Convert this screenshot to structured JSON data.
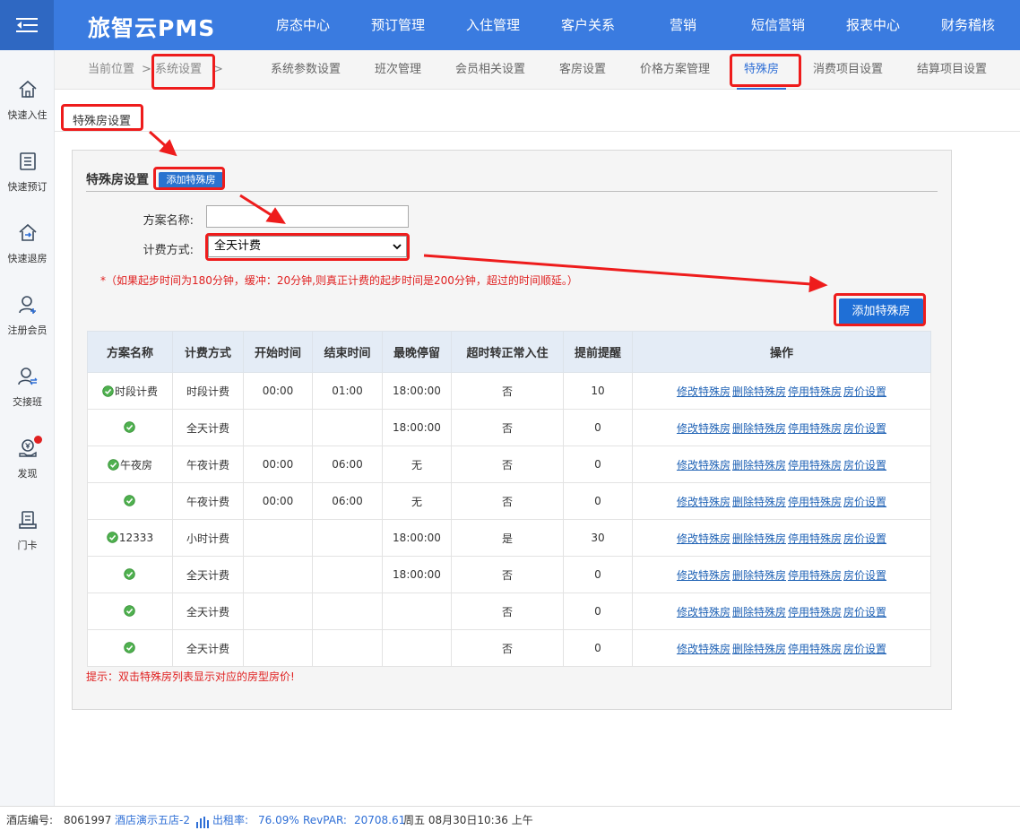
{
  "app": {
    "logo": "旅智云PMS",
    "menu_icon": "menu-collapse-icon"
  },
  "topnav": [
    "房态中心",
    "预订管理",
    "入住管理",
    "客户关系",
    "营销",
    "短信营销",
    "报表中心",
    "财务稽核"
  ],
  "sidebar": [
    {
      "label": "快速入住",
      "icon": "home-icon"
    },
    {
      "label": "快速预订",
      "icon": "list-doc-icon"
    },
    {
      "label": "快速退房",
      "icon": "checkout-icon"
    },
    {
      "label": "注册会员",
      "icon": "add-user-icon"
    },
    {
      "label": "交接班",
      "icon": "shift-swap-icon"
    },
    {
      "label": "发现",
      "icon": "discover-money-icon"
    },
    {
      "label": "门卡",
      "icon": "door-card-icon"
    }
  ],
  "breadcrumb": {
    "prefix": "当前位置",
    "sep1": ">",
    "current": "系统设置",
    "sep2": ">"
  },
  "subtabs": [
    "系统参数设置",
    "班次管理",
    "会员相关设置",
    "客房设置",
    "价格方案管理",
    "特殊房",
    "消费项目设置",
    "结算项目设置"
  ],
  "page_title": "特殊房设置",
  "panel": {
    "heading": "特殊房设置",
    "mini_add_label": "添加特殊房",
    "plan_name_label": "方案名称:",
    "plan_name_value": "",
    "billing_label": "计费方式:",
    "billing_selected": "全天计费",
    "note": "*（如果起步时间为180分钟，缓冲：20分钟,则真正计费的起步时间是200分钟，超过的时间顺延。）",
    "add_button_label": "添加特殊房",
    "hint": "提示：双击特殊房列表显示对应的房型房价!"
  },
  "table": {
    "headers": [
      "方案名称",
      "计费方式",
      "开始时间",
      "结束时间",
      "最晚停留",
      "超时转正常入住",
      "提前提醒",
      "操作"
    ],
    "rows": [
      {
        "name": "时段计费",
        "billing": "时段计费",
        "start": "00:00",
        "end": "01:00",
        "latest": "18:00:00",
        "overtime": "否",
        "remind": "10"
      },
      {
        "name": "",
        "billing": "全天计费",
        "start": "",
        "end": "",
        "latest": "18:00:00",
        "overtime": "否",
        "remind": "0"
      },
      {
        "name": "午夜房",
        "billing": "午夜计费",
        "start": "00:00",
        "end": "06:00",
        "latest": "无",
        "overtime": "否",
        "remind": "0"
      },
      {
        "name": "",
        "billing": "午夜计费",
        "start": "00:00",
        "end": "06:00",
        "latest": "无",
        "overtime": "否",
        "remind": "0"
      },
      {
        "name": "12333",
        "billing": "小时计费",
        "start": "",
        "end": "",
        "latest": "18:00:00",
        "overtime": "是",
        "remind": "30"
      },
      {
        "name": "",
        "billing": "全天计费",
        "start": "",
        "end": "",
        "latest": "18:00:00",
        "overtime": "否",
        "remind": "0"
      },
      {
        "name": "",
        "billing": "全天计费",
        "start": "",
        "end": "",
        "latest": "",
        "overtime": "否",
        "remind": "0"
      },
      {
        "name": "",
        "billing": "全天计费",
        "start": "",
        "end": "",
        "latest": "",
        "overtime": "否",
        "remind": "0"
      }
    ],
    "actions": [
      "修改特殊房",
      "删除特殊房",
      "停用特殊房",
      "房价设置"
    ]
  },
  "status": {
    "hotel_no_label": "酒店编号:",
    "hotel_no": "8061997",
    "hotel_name": "酒店演示五店-2",
    "occupancy_label": "出租率:",
    "occupancy": "76.09%",
    "revpar_label": "RevPAR:",
    "revpar": "20708.61",
    "datetime": "周五 08月30日10:36 上午"
  },
  "colors": {
    "primary": "#3a7be0",
    "highlight_red": "#ee1c1c",
    "note_red": "#e02020",
    "link": "#1f62b5"
  }
}
